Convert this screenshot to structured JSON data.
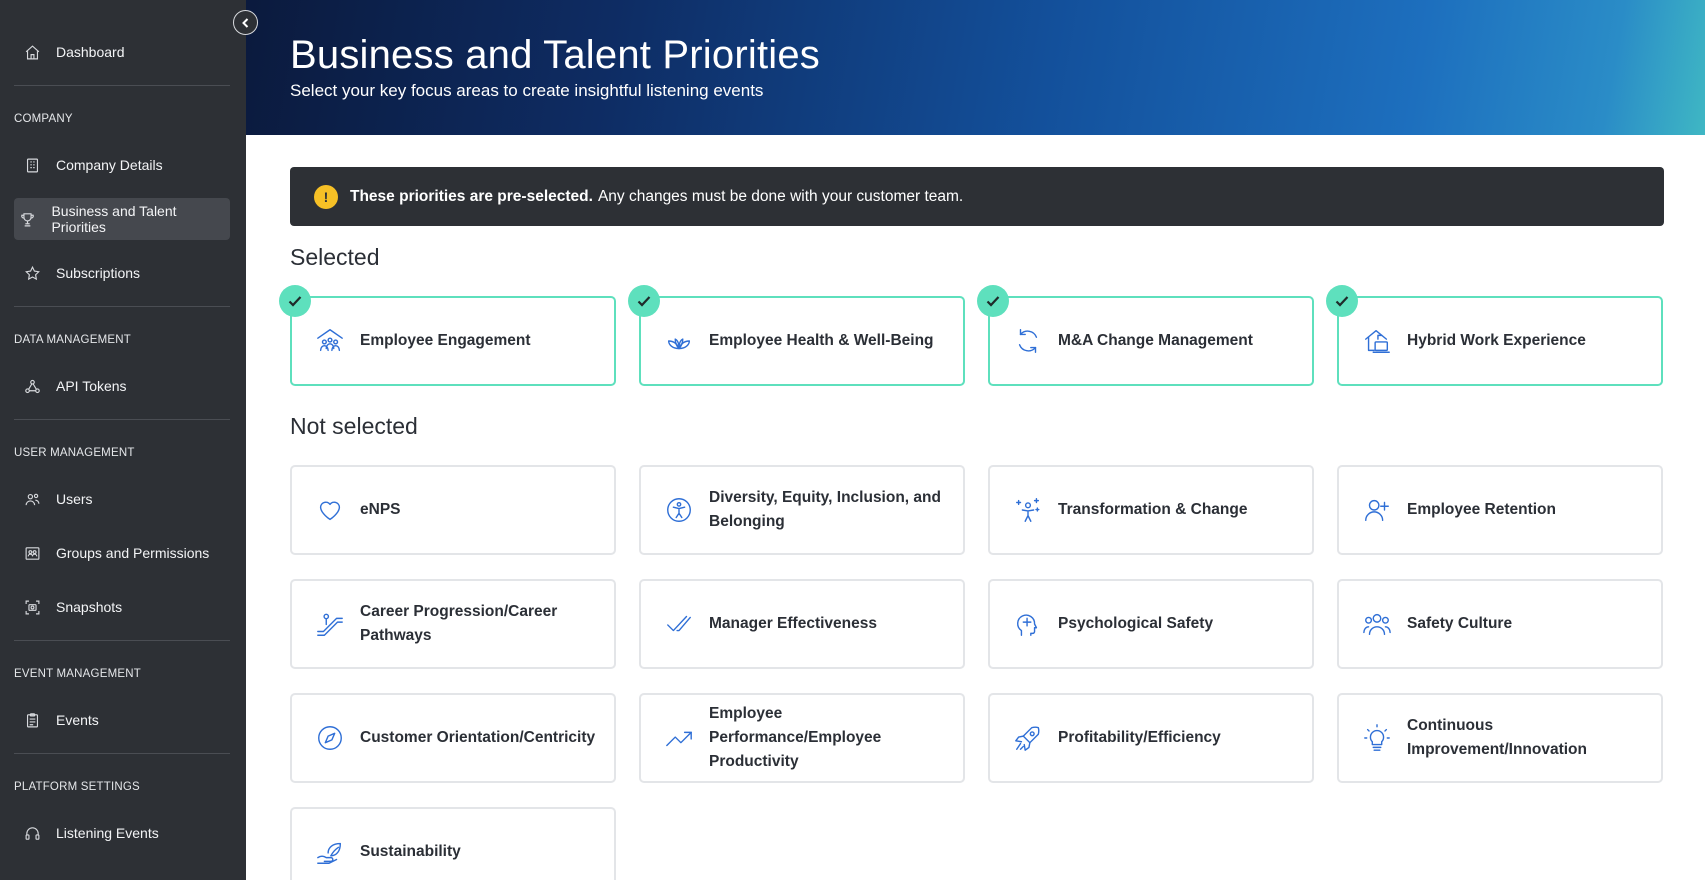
{
  "sidebar": {
    "dashboard": "Dashboard",
    "sections": {
      "company": "COMPANY",
      "data_management": "DATA MANAGEMENT",
      "user_management": "USER MANAGEMENT",
      "event_management": "EVENT MANAGEMENT",
      "platform_settings": "PLATFORM SETTINGS"
    },
    "items": {
      "company_details": "Company Details",
      "business_priorities": "Business and Talent Priorities",
      "subscriptions": "Subscriptions",
      "api_tokens": "API Tokens",
      "users": "Users",
      "groups": "Groups and Permissions",
      "snapshots": "Snapshots",
      "events": "Events",
      "listening_events": "Listening Events"
    }
  },
  "header": {
    "title": "Business and Talent Priorities",
    "subtitle": "Select your key focus areas to create insightful listening events"
  },
  "alert": {
    "bold": "These priorities are pre-selected.",
    "text": "Any changes must be done with your customer team."
  },
  "selected_title": "Selected",
  "not_selected_title": "Not selected",
  "selected": [
    {
      "label": "Employee Engagement",
      "icon": "engagement-icon"
    },
    {
      "label": "Employee Health & Well-Being",
      "icon": "lotus-icon"
    },
    {
      "label": "M&A Change Management",
      "icon": "refresh-icon"
    },
    {
      "label": "Hybrid Work Experience",
      "icon": "home-work-icon"
    }
  ],
  "not_selected": [
    {
      "label": "eNPS",
      "icon": "heart-icon"
    },
    {
      "label": "Diversity, Equity, Inclusion, and Belonging",
      "icon": "accessibility-icon"
    },
    {
      "label": "Transformation & Change",
      "icon": "sparkle-person-icon"
    },
    {
      "label": "Employee Retention",
      "icon": "user-plus-icon"
    },
    {
      "label": "Career Progression/Career Pathways",
      "icon": "escalator-icon"
    },
    {
      "label": "Manager Effectiveness",
      "icon": "double-check-icon"
    },
    {
      "label": "Psychological Safety",
      "icon": "head-plus-icon"
    },
    {
      "label": "Safety Culture",
      "icon": "users-group-icon"
    },
    {
      "label": "Customer Orientation/Centricity",
      "icon": "compass-icon"
    },
    {
      "label": "Employee Performance/Employee Productivity",
      "icon": "trend-up-icon"
    },
    {
      "label": "Profitability/Efficiency",
      "icon": "rocket-icon"
    },
    {
      "label": "Continuous Improvement/Innovation",
      "icon": "lightbulb-icon"
    },
    {
      "label": "Sustainability",
      "icon": "leaf-hand-icon"
    }
  ]
}
